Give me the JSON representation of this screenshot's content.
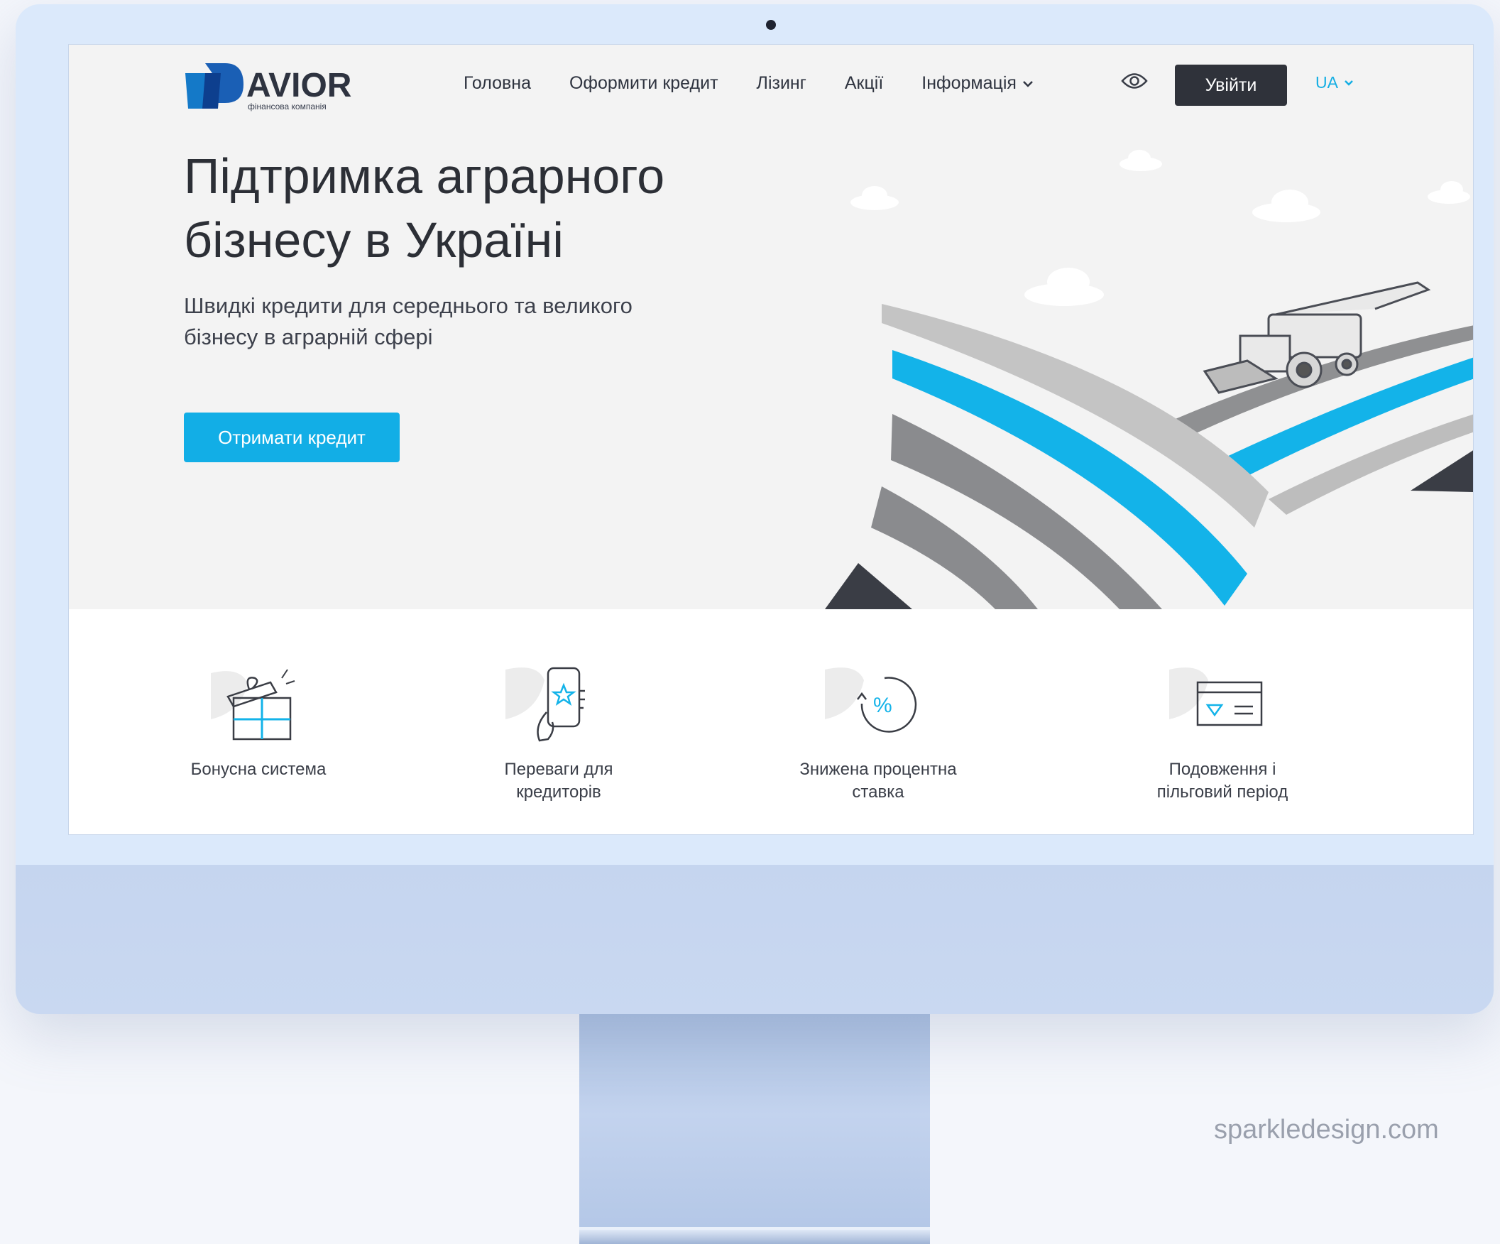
{
  "brand": {
    "name": "AVIOR",
    "tagline": "фінансова компанія",
    "color_primary": "#12aee6",
    "color_dark": "#2f323a"
  },
  "nav": {
    "items": [
      "Головна",
      "Оформити кредит",
      "Лізинг",
      "Акції",
      "Інформація"
    ],
    "login_label": "Увійти",
    "language": "UA"
  },
  "hero": {
    "title_line1": "Підтримка аграрного",
    "title_line2": "бізнесу в Україні",
    "subtitle_line1": "Швидкі кредити для середнього та великого",
    "subtitle_line2": "бізнесу в аграрній сфері",
    "cta_label": "Отримати кредит"
  },
  "features": [
    {
      "icon": "gift-icon",
      "line1": "Бонусна система",
      "line2": ""
    },
    {
      "icon": "phone-star-icon",
      "line1": "Переваги для",
      "line2": "кредиторів"
    },
    {
      "icon": "percent-icon",
      "line1": "Знижена процентна",
      "line2": "ставка"
    },
    {
      "icon": "card-icon",
      "line1": "Подовження і",
      "line2": "пільговий період"
    }
  ],
  "watermark": "sparkledesign.com"
}
